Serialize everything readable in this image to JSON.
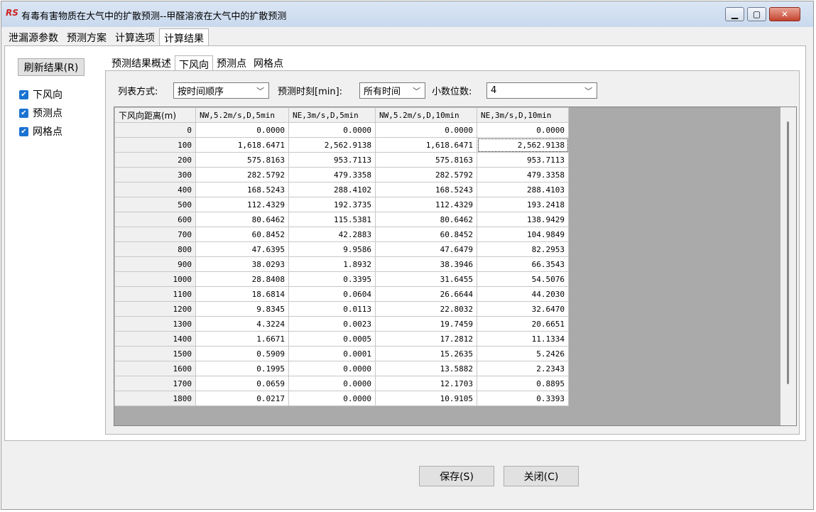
{
  "window": {
    "title": "有毒有害物质在大气中的扩散预测--甲醛溶液在大气中的扩散预测",
    "app_icon": "RS"
  },
  "tabs_top": [
    {
      "label": "泄漏源参数"
    },
    {
      "label": "预测方案"
    },
    {
      "label": "计算选项"
    },
    {
      "label": "计算结果"
    }
  ],
  "left": {
    "refresh_label": "刷新结果(R)",
    "checkboxes": [
      {
        "label": "下风向",
        "checked": true
      },
      {
        "label": "预测点",
        "checked": true
      },
      {
        "label": "网格点",
        "checked": true
      }
    ]
  },
  "tabs_sub": [
    {
      "label": "预测结果概述"
    },
    {
      "label": "下风向"
    },
    {
      "label": "预测点"
    },
    {
      "label": "网格点"
    }
  ],
  "filters": {
    "list_mode_label": "列表方式:",
    "list_mode_value": "按时间顺序",
    "time_label": "预测时刻[min]:",
    "time_value": "所有时间",
    "decimals_label": "小数位数:",
    "decimals_value": "4"
  },
  "table": {
    "headers": [
      "下风向距离(m)",
      "NW,5.2m/s,D,5min",
      "NE,3m/s,D,5min",
      "NW,5.2m/s,D,10min",
      "NE,3m/s,D,10min"
    ],
    "rows": [
      [
        "0",
        "0.0000",
        "0.0000",
        "0.0000",
        "0.0000"
      ],
      [
        "100",
        "1,618.6471",
        "2,562.9138",
        "1,618.6471",
        "2,562.9138"
      ],
      [
        "200",
        "575.8163",
        "953.7113",
        "575.8163",
        "953.7113"
      ],
      [
        "300",
        "282.5792",
        "479.3358",
        "282.5792",
        "479.3358"
      ],
      [
        "400",
        "168.5243",
        "288.4102",
        "168.5243",
        "288.4103"
      ],
      [
        "500",
        "112.4329",
        "192.3735",
        "112.4329",
        "193.2418"
      ],
      [
        "600",
        "80.6462",
        "115.5381",
        "80.6462",
        "138.9429"
      ],
      [
        "700",
        "60.8452",
        "42.2883",
        "60.8452",
        "104.9849"
      ],
      [
        "800",
        "47.6395",
        "9.9586",
        "47.6479",
        "82.2953"
      ],
      [
        "900",
        "38.0293",
        "1.8932",
        "38.3946",
        "66.3543"
      ],
      [
        "1000",
        "28.8408",
        "0.3395",
        "31.6455",
        "54.5076"
      ],
      [
        "1100",
        "18.6814",
        "0.0604",
        "26.6644",
        "44.2030"
      ],
      [
        "1200",
        "9.8345",
        "0.0113",
        "22.8032",
        "32.6470"
      ],
      [
        "1300",
        "4.3224",
        "0.0023",
        "19.7459",
        "20.6651"
      ],
      [
        "1400",
        "1.6671",
        "0.0005",
        "17.2812",
        "11.1334"
      ],
      [
        "1500",
        "0.5909",
        "0.0001",
        "15.2635",
        "5.2426"
      ],
      [
        "1600",
        "0.1995",
        "0.0000",
        "13.5882",
        "2.2343"
      ],
      [
        "1700",
        "0.0659",
        "0.0000",
        "12.1703",
        "0.8895"
      ],
      [
        "1800",
        "0.0217",
        "0.0000",
        "10.9105",
        "0.3393"
      ]
    ]
  },
  "buttons": {
    "save": "保存(S)",
    "close": "关闭(C)"
  },
  "colors": {
    "accent": "#1a73d1",
    "close_button": "#c4432e",
    "grid_bg": "#aaaaaa"
  }
}
